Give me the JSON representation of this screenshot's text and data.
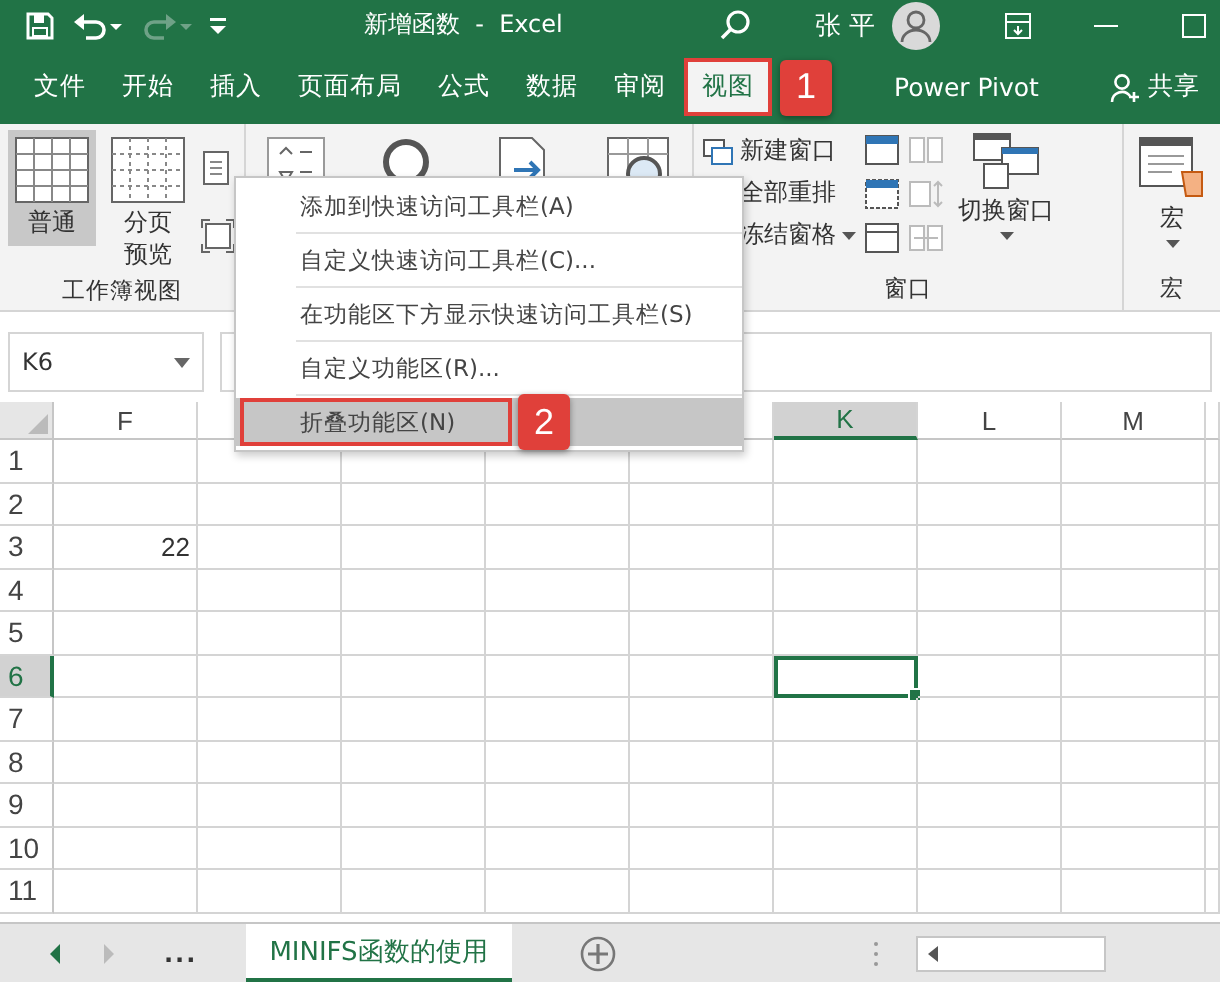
{
  "title_bar": {
    "title": "新增函数  -  Excel",
    "user": "张 平"
  },
  "tabs": [
    {
      "label": "文件",
      "selected": false
    },
    {
      "label": "开始",
      "selected": false
    },
    {
      "label": "插入",
      "selected": false
    },
    {
      "label": "页面布局",
      "selected": false
    },
    {
      "label": "公式",
      "selected": false
    },
    {
      "label": "数据",
      "selected": false
    },
    {
      "label": "审阅",
      "selected": false
    },
    {
      "label": "视图",
      "selected": true
    },
    {
      "label": "Power Pivot",
      "selected": false
    }
  ],
  "share": "共享",
  "callouts": [
    "1",
    "2"
  ],
  "ribbon": {
    "workbook_views": {
      "label": "工作簿视图",
      "buttons": [
        {
          "label": "普通",
          "selected": true
        },
        {
          "label": "分页预览",
          "selected": false
        }
      ]
    },
    "window": {
      "label": "窗口",
      "items": [
        {
          "label": "新建窗口",
          "dropdown": false
        },
        {
          "label": "全部重排",
          "dropdown": false
        },
        {
          "label": "冻结窗格",
          "dropdown": true
        }
      ],
      "switch": "切换窗口"
    },
    "macros": {
      "label": "宏",
      "button": "宏"
    }
  },
  "name_box": "K6",
  "menu": [
    {
      "label": "添加到快速访问工具栏(A)",
      "selected": false
    },
    {
      "label": "自定义快速访问工具栏(C)...",
      "selected": false
    },
    {
      "label": "在功能区下方显示快速访问工具栏(S)",
      "selected": false
    },
    {
      "label": "自定义功能区(R)...",
      "selected": false
    },
    {
      "label": "折叠功能区(N)",
      "selected": true
    }
  ],
  "grid": {
    "columns": [
      {
        "label": "F",
        "selected": false
      },
      {
        "label": "K",
        "selected": true
      },
      {
        "label": "L",
        "selected": false
      },
      {
        "label": "M",
        "selected": false
      }
    ],
    "rows": [
      {
        "label": "1",
        "selected": false,
        "cells": []
      },
      {
        "label": "2",
        "selected": false,
        "cells": []
      },
      {
        "label": "3",
        "selected": false,
        "cells": [
          "22"
        ]
      },
      {
        "label": "4",
        "selected": false,
        "cells": []
      },
      {
        "label": "5",
        "selected": false,
        "cells": []
      },
      {
        "label": "6",
        "selected": true,
        "cells": []
      },
      {
        "label": "7",
        "selected": false,
        "cells": []
      },
      {
        "label": "8",
        "selected": false,
        "cells": []
      },
      {
        "label": "9",
        "selected": false,
        "cells": []
      },
      {
        "label": "10",
        "selected": false,
        "cells": []
      },
      {
        "label": "11",
        "selected": false,
        "cells": []
      }
    ]
  },
  "sheet_tabs": {
    "more": "...",
    "tabs": [
      {
        "label": "MINIFS函数的使用",
        "selected": true
      }
    ]
  }
}
